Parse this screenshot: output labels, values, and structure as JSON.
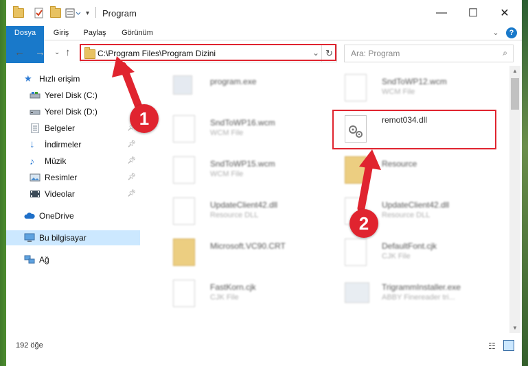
{
  "window": {
    "title": "Program"
  },
  "ribbon": {
    "tabs": [
      "Dosya",
      "Giriş",
      "Paylaş",
      "Görünüm"
    ]
  },
  "address": {
    "path": "C:\\Program Files\\Program Dizini",
    "search_placeholder": "Ara: Program"
  },
  "sidebar": {
    "items": [
      {
        "label": "Hızlı erişim",
        "icon": "star-icon"
      },
      {
        "label": "Yerel Disk (C:)",
        "icon": "drive-icon"
      },
      {
        "label": "Yerel Disk (D:)",
        "icon": "drive-icon"
      },
      {
        "label": "Belgeler",
        "icon": "documents-icon"
      },
      {
        "label": "İndirmeler",
        "icon": "download-icon"
      },
      {
        "label": "Müzik",
        "icon": "music-icon"
      },
      {
        "label": "Resimler",
        "icon": "pictures-icon"
      },
      {
        "label": "Videolar",
        "icon": "video-icon"
      },
      {
        "label": "OneDrive",
        "icon": "cloud-icon"
      },
      {
        "label": "Bu bilgisayar",
        "icon": "computer-icon"
      },
      {
        "label": "Ağ",
        "icon": "network-icon"
      }
    ]
  },
  "files": [
    {
      "name": "program.exe",
      "type": ""
    },
    {
      "name": "SndToWP12.wcm",
      "type": "WCM File"
    },
    {
      "name": "SndToWP16.wcm",
      "type": "WCM File"
    },
    {
      "name": "remot034.dll",
      "type": ""
    },
    {
      "name": "SndToWP15.wcm",
      "type": "WCM File"
    },
    {
      "name": "Resource",
      "type": ""
    },
    {
      "name": "UpdateClient42.dll",
      "type": "Resource DLL"
    },
    {
      "name": "UpdateClient42.dll",
      "type": "Resource DLL"
    },
    {
      "name": "Microsoft.VC90.CRT",
      "type": ""
    },
    {
      "name": "DefaultFont.cjk",
      "type": "CJK File"
    },
    {
      "name": "FastKorn.cjk",
      "type": "CJK File"
    },
    {
      "name": "TrigrammInstaller.exe",
      "type": "ABBY Finereader tri..."
    }
  ],
  "status": {
    "count": "192 öğe"
  },
  "annotations": {
    "step1": "1",
    "step2": "2",
    "accent": "#e0242f"
  }
}
